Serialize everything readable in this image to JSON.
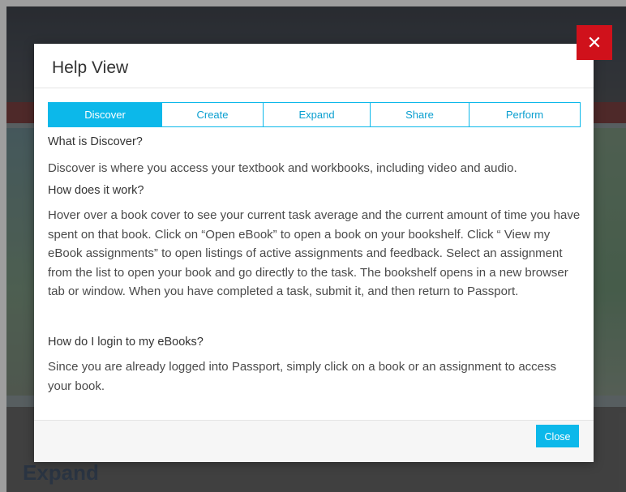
{
  "modal": {
    "title": "Help View",
    "close_icon_glyph": "✕",
    "close_button_label": "Close"
  },
  "tabs": [
    {
      "label": "Discover",
      "active": true
    },
    {
      "label": "Create",
      "active": false
    },
    {
      "label": "Expand",
      "active": false
    },
    {
      "label": "Share",
      "active": false
    },
    {
      "label": "Perform",
      "active": false
    }
  ],
  "content": {
    "q1": "What is Discover?",
    "a1": "Discover is where you access your textbook and workbooks, including video and audio.",
    "q2": "How does it work?",
    "a2": "Hover over a book cover to see your current task average and the current amount of time you have spent on that book. Click on “Open eBook” to open a book on your bookshelf. Click “ View my eBook assignments” to open listings of active assignments and feedback. Select an assignment from the list to open your book and go directly to the task. The bookshelf opens in a new browser tab or window. When you have completed a task, submit it, and then return to Passport.",
    "q3": "How do I login to my eBooks?",
    "a3": "Since you are already logged into Passport, simply click on a book or an assignment to access your book."
  },
  "background": {
    "footer_title": "Expand"
  },
  "colors": {
    "accent": "#0cb8ea",
    "close_red": "#d0111b"
  }
}
